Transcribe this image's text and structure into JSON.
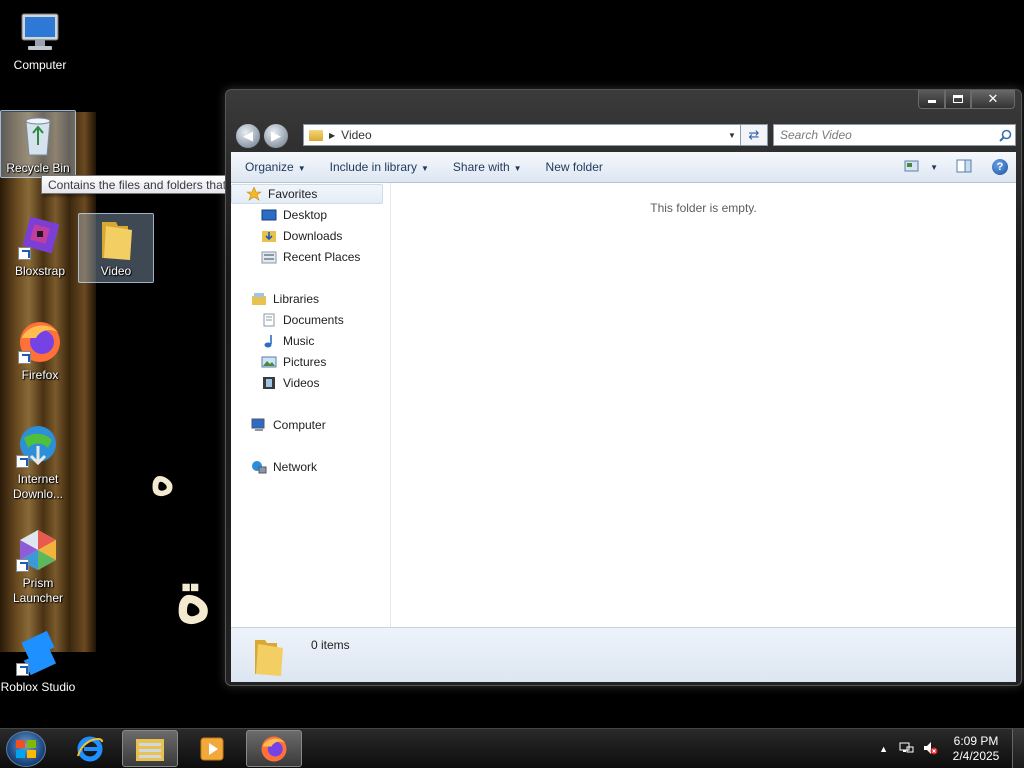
{
  "desktop": {
    "icons": [
      {
        "label": "Computer",
        "icon": "computer-icon"
      },
      {
        "label": "Recycle Bin",
        "icon": "recycle-bin-icon"
      },
      {
        "label": "Bloxstrap",
        "icon": "bloxstrap-icon"
      },
      {
        "label": "Video",
        "icon": "folder-icon"
      },
      {
        "label": "Firefox",
        "icon": "firefox-icon"
      },
      {
        "label": "Internet Downlo...",
        "icon": "internet-download-manager-icon"
      },
      {
        "label": "Prism Launcher",
        "icon": "prism-launcher-icon"
      },
      {
        "label": "Roblox Studio",
        "icon": "roblox-studio-icon"
      }
    ],
    "tooltip": "Contains the files and folders that you have deleted."
  },
  "window": {
    "address": {
      "path": "Video"
    },
    "search_placeholder": "Search Video",
    "commands": [
      {
        "label": "Organize",
        "dropdown": true
      },
      {
        "label": "Include in library",
        "dropdown": true
      },
      {
        "label": "Share with",
        "dropdown": true
      },
      {
        "label": "New folder",
        "dropdown": false
      }
    ],
    "nav": {
      "favorites": {
        "label": "Favorites",
        "items": [
          "Desktop",
          "Downloads",
          "Recent Places"
        ]
      },
      "libraries": {
        "label": "Libraries",
        "items": [
          "Documents",
          "Music",
          "Pictures",
          "Videos"
        ]
      },
      "computer": "Computer",
      "network": "Network"
    },
    "empty_message": "This folder is empty.",
    "status": {
      "items_count": "0 items"
    }
  },
  "taskbar": {
    "pinned": [
      "start-orb",
      "internet-explorer-icon",
      "windows-explorer-icon",
      "media-player-icon",
      "firefox-icon"
    ],
    "clock": {
      "time": "6:09 PM",
      "date": "2/4/2025"
    }
  },
  "colors": {
    "accent": "#1e395b",
    "folder": "#e8c14e",
    "command_bar_top": "#f6f9fd",
    "command_bar_bottom": "#dde6f1"
  }
}
